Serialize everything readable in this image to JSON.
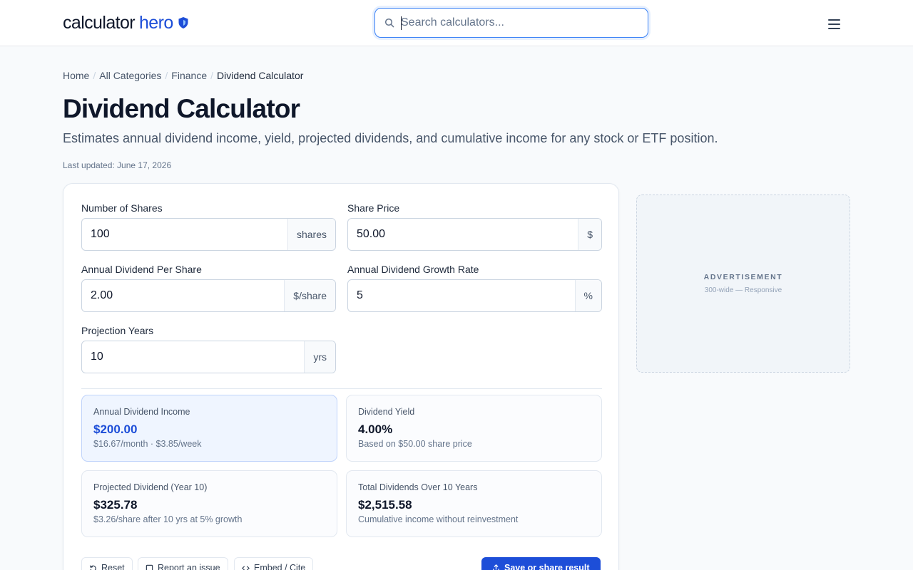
{
  "header": {
    "logo_part1": "calculator",
    "logo_part2": "hero",
    "search_placeholder": "Search calculators...",
    "accent_color": "#1d4ed8"
  },
  "breadcrumb": [
    "Home",
    "All Categories",
    "Finance",
    "Dividend Calculator"
  ],
  "page": {
    "title": "Dividend Calculator",
    "description": "Estimates annual dividend income, yield, projected dividends, and cumulative income for any stock or ETF position.",
    "updated": "Last updated: June 17, 2026"
  },
  "fields": {
    "shares": {
      "label": "Number of Shares",
      "value": "100",
      "suffix": "shares"
    },
    "price": {
      "label": "Share Price",
      "value": "50.00",
      "suffix": "$"
    },
    "dps": {
      "label": "Annual Dividend Per Share",
      "value": "2.00",
      "suffix": "$/share"
    },
    "growth": {
      "label": "Annual Dividend Growth Rate",
      "value": "5",
      "suffix": "%"
    },
    "years": {
      "label": "Projection Years",
      "value": "10",
      "suffix": "yrs"
    }
  },
  "results": {
    "income": {
      "label": "Annual Dividend Income",
      "value": "$200.00",
      "note": "$16.67/month · $3.85/week"
    },
    "yield": {
      "label": "Dividend Yield",
      "value": "4.00%",
      "note": "Based on $50.00 share price"
    },
    "projected": {
      "label": "Projected Dividend (Year 10)",
      "value": "$325.78",
      "note": "$3.26/share after 10 yrs at 5% growth"
    },
    "total": {
      "label": "Total Dividends Over 10 Years",
      "value": "$2,515.58",
      "note": "Cumulative income without reinvestment"
    }
  },
  "actions": {
    "reset": "Reset",
    "report": "Report an issue",
    "embed": "Embed / Cite",
    "save": "Save or share result"
  },
  "ad": {
    "title": "ADVERTISEMENT",
    "subtitle": "300-wide — Responsive"
  },
  "icons": [
    "shield-icon",
    "search-icon",
    "menu-icon",
    "reset-icon",
    "flag-icon",
    "code-icon",
    "share-icon"
  ]
}
